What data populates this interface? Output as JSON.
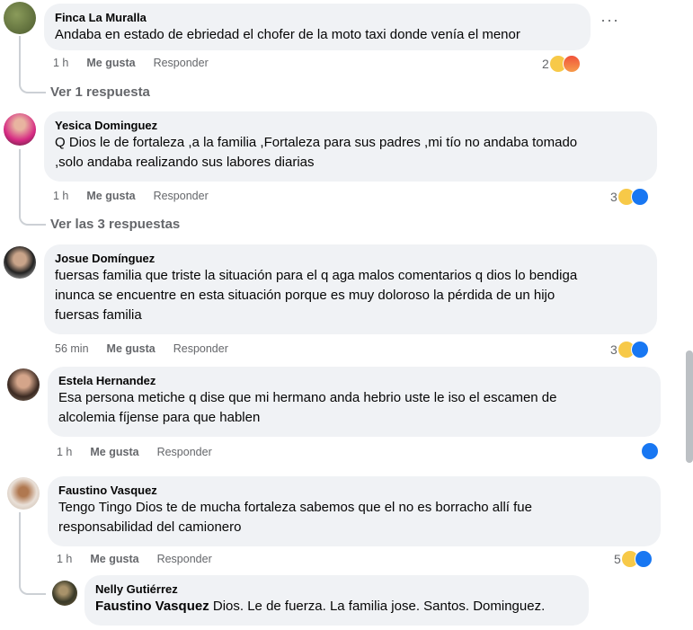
{
  "comments": [
    {
      "name": "Finca La Muralla",
      "text_lines": [
        "Andaba en estado de ebriedad el chofer de la moto taxi donde venía el menor"
      ],
      "time": "1 h",
      "like": "Me gusta",
      "reply": "Responder",
      "reaction_count": "2",
      "reactions": [
        "sad-icon",
        "angry-icon"
      ],
      "replies_link": "Ver 1 respuesta"
    },
    {
      "name": "Yesica Dominguez",
      "text_lines": [
        "Q Dios le de fortaleza ,a la familia ,Fortaleza para sus padres ,mi tío no andaba tomado",
        ",solo andaba realizando sus labores diarias"
      ],
      "time": "1 h",
      "like": "Me gusta",
      "reply": "Responder",
      "reaction_count": "3",
      "reactions": [
        "sad-icon",
        "like-icon"
      ],
      "replies_link": "Ver las 3 respuestas"
    },
    {
      "name": "Josue Domínguez",
      "text_lines": [
        "fuersas familia que triste la situación para el q aga malos comentarios q dios lo bendiga",
        "inunca se encuentre en esta situación porque es muy doloroso la pérdida de un hijo",
        "fuersas familia"
      ],
      "time": "56 min",
      "like": "Me gusta",
      "reply": "Responder",
      "reaction_count": "3",
      "reactions": [
        "sad-icon",
        "like-icon"
      ]
    },
    {
      "name": "Estela Hernandez",
      "text_lines": [
        "Esa persona metiche q dise que mi hermano anda hebrio uste le iso el escamen de",
        "alcolemia fíjense para que hablen"
      ],
      "time": "1 h",
      "like": "Me gusta",
      "reply": "Responder",
      "reaction_count": "",
      "reactions": [
        "like-icon"
      ]
    },
    {
      "name": "Faustino Vasquez",
      "text_lines": [
        "Tengo Tingo Dios te de mucha fortaleza sabemos que el no es borracho allí fue",
        "responsabilidad del camionero"
      ],
      "time": "1 h",
      "like": "Me gusta",
      "reply": "Responder",
      "reaction_count": "5",
      "reactions": [
        "sad-icon",
        "like-icon"
      ]
    }
  ],
  "reply": {
    "name": "Nelly Gutiérrez",
    "mention": "Faustino Vasquez",
    "text": " Dios. Le de fuerza. La familia jose. Santos. Dominguez."
  },
  "more_options": "···",
  "colors": {
    "bubble": "#f0f2f5",
    "meta": "#65676b",
    "like_blue": "#1877f2"
  }
}
